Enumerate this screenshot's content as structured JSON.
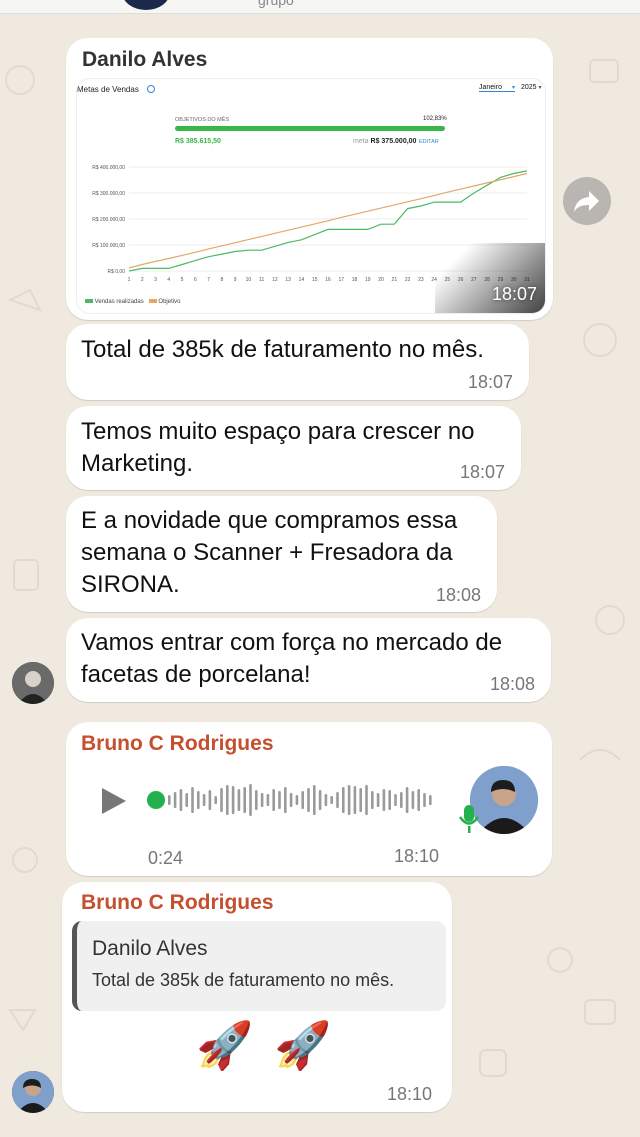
{
  "topbar": {
    "title": "grupo"
  },
  "messages": {
    "m1": {
      "sender": "Danilo Alves",
      "time": "18:07",
      "image": {
        "title": "Metas de Vendas",
        "month_select": "Janeiro",
        "year_select": "2025",
        "objectives_label": "OBJETIVOS DO MÊS",
        "objectives_pct": "102,83%",
        "realized": "R$ 385.615,50",
        "meta_label": "meta",
        "meta_value": "R$ 375.000,00",
        "edit_label": "EDITAR",
        "legend_sales": "Vendas realizadas",
        "legend_goal": "Objetivo"
      }
    },
    "m2": {
      "text": "Total de 385k de faturamento no mês.",
      "time": "18:07"
    },
    "m3": {
      "line1": "Temos muito espaço para crescer no",
      "line2": "Marketing.",
      "time": "18:07"
    },
    "m4": {
      "line1": "E a novidade que compramos essa",
      "line2": "semana o Scanner + Fresadora da",
      "line3": "SIRONA.",
      "time": "18:08"
    },
    "m5": {
      "line1": "Vamos entrar com força no mercado de",
      "line2": "facetas de porcelana!",
      "time": "18:08"
    },
    "m6": {
      "sender": "Bruno C Rodrigues",
      "duration": "0:24",
      "time": "18:10"
    },
    "m7": {
      "sender": "Bruno C Rodrigues",
      "quote_sender": "Danilo Alves",
      "quote_text": "Total de 385k de faturamento no mês.",
      "emoji": "🚀 🚀",
      "time": "18:10"
    }
  },
  "colors": {
    "sender_danilo": "#333333",
    "sender_bruno": "#c4502f",
    "progress": "#3ab54a",
    "goal_line": "#e3a868",
    "sales_line": "#4cb963"
  },
  "chart_data": {
    "type": "line",
    "x": [
      1,
      2,
      3,
      4,
      5,
      6,
      7,
      8,
      9,
      10,
      11,
      12,
      13,
      14,
      15,
      16,
      17,
      18,
      19,
      20,
      21,
      22,
      23,
      24,
      25,
      26,
      27,
      28,
      29,
      30,
      31
    ],
    "yticks": [
      "R$ 0,00",
      "R$ 100.000,00",
      "R$ 200.000,00",
      "R$ 300.000,00",
      "R$ 400.000,00"
    ],
    "ylim": [
      0,
      400000
    ],
    "series": [
      {
        "name": "Vendas realizadas",
        "values": [
          0,
          10000,
          10000,
          10000,
          25000,
          40000,
          55000,
          65000,
          75000,
          80000,
          80000,
          95000,
          110000,
          120000,
          140000,
          160000,
          160000,
          160000,
          160000,
          180000,
          180000,
          240000,
          250000,
          265000,
          265000,
          265000,
          300000,
          330000,
          360000,
          375000,
          385000
        ]
      },
      {
        "name": "Objetivo",
        "values": [
          12000,
          25000,
          37000,
          48000,
          60000,
          72000,
          85000,
          97000,
          109000,
          121000,
          133000,
          145000,
          157000,
          169000,
          181000,
          193000,
          206000,
          218000,
          230000,
          242000,
          254000,
          266000,
          278000,
          290000,
          303000,
          315000,
          327000,
          339000,
          351000,
          363000,
          375000
        ]
      }
    ]
  }
}
